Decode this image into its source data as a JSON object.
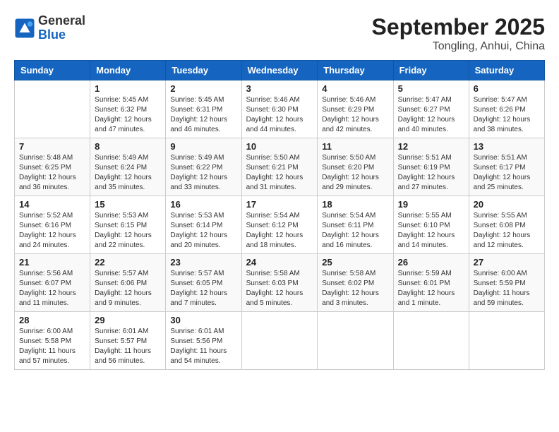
{
  "header": {
    "logo_line1": "General",
    "logo_line2": "Blue",
    "month_title": "September 2025",
    "location": "Tongling, Anhui, China"
  },
  "weekdays": [
    "Sunday",
    "Monday",
    "Tuesday",
    "Wednesday",
    "Thursday",
    "Friday",
    "Saturday"
  ],
  "weeks": [
    [
      {
        "day": "",
        "info": ""
      },
      {
        "day": "1",
        "info": "Sunrise: 5:45 AM\nSunset: 6:32 PM\nDaylight: 12 hours\nand 47 minutes."
      },
      {
        "day": "2",
        "info": "Sunrise: 5:45 AM\nSunset: 6:31 PM\nDaylight: 12 hours\nand 46 minutes."
      },
      {
        "day": "3",
        "info": "Sunrise: 5:46 AM\nSunset: 6:30 PM\nDaylight: 12 hours\nand 44 minutes."
      },
      {
        "day": "4",
        "info": "Sunrise: 5:46 AM\nSunset: 6:29 PM\nDaylight: 12 hours\nand 42 minutes."
      },
      {
        "day": "5",
        "info": "Sunrise: 5:47 AM\nSunset: 6:27 PM\nDaylight: 12 hours\nand 40 minutes."
      },
      {
        "day": "6",
        "info": "Sunrise: 5:47 AM\nSunset: 6:26 PM\nDaylight: 12 hours\nand 38 minutes."
      }
    ],
    [
      {
        "day": "7",
        "info": "Sunrise: 5:48 AM\nSunset: 6:25 PM\nDaylight: 12 hours\nand 36 minutes."
      },
      {
        "day": "8",
        "info": "Sunrise: 5:49 AM\nSunset: 6:24 PM\nDaylight: 12 hours\nand 35 minutes."
      },
      {
        "day": "9",
        "info": "Sunrise: 5:49 AM\nSunset: 6:22 PM\nDaylight: 12 hours\nand 33 minutes."
      },
      {
        "day": "10",
        "info": "Sunrise: 5:50 AM\nSunset: 6:21 PM\nDaylight: 12 hours\nand 31 minutes."
      },
      {
        "day": "11",
        "info": "Sunrise: 5:50 AM\nSunset: 6:20 PM\nDaylight: 12 hours\nand 29 minutes."
      },
      {
        "day": "12",
        "info": "Sunrise: 5:51 AM\nSunset: 6:19 PM\nDaylight: 12 hours\nand 27 minutes."
      },
      {
        "day": "13",
        "info": "Sunrise: 5:51 AM\nSunset: 6:17 PM\nDaylight: 12 hours\nand 25 minutes."
      }
    ],
    [
      {
        "day": "14",
        "info": "Sunrise: 5:52 AM\nSunset: 6:16 PM\nDaylight: 12 hours\nand 24 minutes."
      },
      {
        "day": "15",
        "info": "Sunrise: 5:53 AM\nSunset: 6:15 PM\nDaylight: 12 hours\nand 22 minutes."
      },
      {
        "day": "16",
        "info": "Sunrise: 5:53 AM\nSunset: 6:14 PM\nDaylight: 12 hours\nand 20 minutes."
      },
      {
        "day": "17",
        "info": "Sunrise: 5:54 AM\nSunset: 6:12 PM\nDaylight: 12 hours\nand 18 minutes."
      },
      {
        "day": "18",
        "info": "Sunrise: 5:54 AM\nSunset: 6:11 PM\nDaylight: 12 hours\nand 16 minutes."
      },
      {
        "day": "19",
        "info": "Sunrise: 5:55 AM\nSunset: 6:10 PM\nDaylight: 12 hours\nand 14 minutes."
      },
      {
        "day": "20",
        "info": "Sunrise: 5:55 AM\nSunset: 6:08 PM\nDaylight: 12 hours\nand 12 minutes."
      }
    ],
    [
      {
        "day": "21",
        "info": "Sunrise: 5:56 AM\nSunset: 6:07 PM\nDaylight: 12 hours\nand 11 minutes."
      },
      {
        "day": "22",
        "info": "Sunrise: 5:57 AM\nSunset: 6:06 PM\nDaylight: 12 hours\nand 9 minutes."
      },
      {
        "day": "23",
        "info": "Sunrise: 5:57 AM\nSunset: 6:05 PM\nDaylight: 12 hours\nand 7 minutes."
      },
      {
        "day": "24",
        "info": "Sunrise: 5:58 AM\nSunset: 6:03 PM\nDaylight: 12 hours\nand 5 minutes."
      },
      {
        "day": "25",
        "info": "Sunrise: 5:58 AM\nSunset: 6:02 PM\nDaylight: 12 hours\nand 3 minutes."
      },
      {
        "day": "26",
        "info": "Sunrise: 5:59 AM\nSunset: 6:01 PM\nDaylight: 12 hours\nand 1 minute."
      },
      {
        "day": "27",
        "info": "Sunrise: 6:00 AM\nSunset: 5:59 PM\nDaylight: 11 hours\nand 59 minutes."
      }
    ],
    [
      {
        "day": "28",
        "info": "Sunrise: 6:00 AM\nSunset: 5:58 PM\nDaylight: 11 hours\nand 57 minutes."
      },
      {
        "day": "29",
        "info": "Sunrise: 6:01 AM\nSunset: 5:57 PM\nDaylight: 11 hours\nand 56 minutes."
      },
      {
        "day": "30",
        "info": "Sunrise: 6:01 AM\nSunset: 5:56 PM\nDaylight: 11 hours\nand 54 minutes."
      },
      {
        "day": "",
        "info": ""
      },
      {
        "day": "",
        "info": ""
      },
      {
        "day": "",
        "info": ""
      },
      {
        "day": "",
        "info": ""
      }
    ]
  ]
}
